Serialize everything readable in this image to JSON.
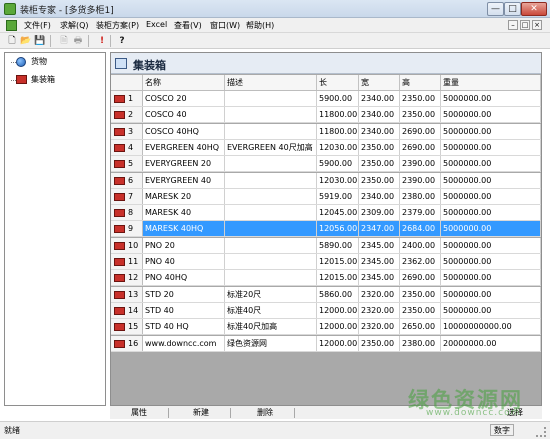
{
  "window": {
    "title": "装柜专家 - [多货多柜1]",
    "controls": {
      "minimize": "—",
      "maximize": "□",
      "close": "✕"
    }
  },
  "menubar": {
    "items": [
      "文件(F)",
      "求解(Q)",
      "装柜方案(P)",
      "Excel",
      "查看(V)",
      "窗口(W)",
      "帮助(H)"
    ],
    "mdi_controls": [
      "–",
      "□",
      "×"
    ]
  },
  "toolbar": {
    "glyphs": [
      "🗋",
      "📂",
      "💾",
      "🗎",
      "🖶",
      "!",
      "?"
    ]
  },
  "tree": {
    "items": [
      {
        "label": "货物",
        "icon": "ball-icon"
      },
      {
        "label": "集装箱",
        "icon": "container-icon"
      }
    ]
  },
  "panel": {
    "title": "集装箱"
  },
  "table": {
    "columns": [
      "名称",
      "描述",
      "长",
      "宽",
      "高",
      "重量"
    ],
    "rows": [
      {
        "num": "1",
        "name": "COSCO 20",
        "desc": "",
        "length": "5900.00",
        "width": "2340.00",
        "height": "2350.00",
        "weight": "5000000.00"
      },
      {
        "num": "2",
        "name": "COSCO 40",
        "desc": "",
        "length": "11800.00",
        "width": "2340.00",
        "height": "2350.00",
        "weight": "5000000.00"
      },
      {
        "num": "3",
        "name": "COSCO 40HQ",
        "desc": "",
        "length": "11800.00",
        "width": "2340.00",
        "height": "2690.00",
        "weight": "5000000.00"
      },
      {
        "num": "4",
        "name": "EVERGREEN 40HQ",
        "desc": "EVERGREEN 40尺加高",
        "length": "12030.00",
        "width": "2350.00",
        "height": "2690.00",
        "weight": "5000000.00"
      },
      {
        "num": "5",
        "name": "EVERYGREEN 20",
        "desc": "",
        "length": "5900.00",
        "width": "2350.00",
        "height": "2390.00",
        "weight": "5000000.00"
      },
      {
        "num": "6",
        "name": "EVERYGREEN 40",
        "desc": "",
        "length": "12030.00",
        "width": "2350.00",
        "height": "2390.00",
        "weight": "5000000.00"
      },
      {
        "num": "7",
        "name": "MARESK 20",
        "desc": "",
        "length": "5919.00",
        "width": "2340.00",
        "height": "2380.00",
        "weight": "5000000.00"
      },
      {
        "num": "8",
        "name": "MARESK 40",
        "desc": "",
        "length": "12045.00",
        "width": "2309.00",
        "height": "2379.00",
        "weight": "5000000.00"
      },
      {
        "num": "9",
        "name": "MARESK 40HQ",
        "desc": "",
        "length": "12056.00",
        "width": "2347.00",
        "height": "2684.00",
        "weight": "5000000.00"
      },
      {
        "num": "10",
        "name": "PNO 20",
        "desc": "",
        "length": "5890.00",
        "width": "2345.00",
        "height": "2400.00",
        "weight": "5000000.00"
      },
      {
        "num": "11",
        "name": "PNO 40",
        "desc": "",
        "length": "12015.00",
        "width": "2345.00",
        "height": "2362.00",
        "weight": "5000000.00"
      },
      {
        "num": "12",
        "name": "PNO 40HQ",
        "desc": "",
        "length": "12015.00",
        "width": "2345.00",
        "height": "2690.00",
        "weight": "5000000.00"
      },
      {
        "num": "13",
        "name": "STD 20",
        "desc": "标准20尺",
        "length": "5860.00",
        "width": "2320.00",
        "height": "2350.00",
        "weight": "5000000.00"
      },
      {
        "num": "14",
        "name": "STD 40",
        "desc": "标准40尺",
        "length": "12000.00",
        "width": "2320.00",
        "height": "2350.00",
        "weight": "5000000.00"
      },
      {
        "num": "15",
        "name": "STD 40 HQ",
        "desc": "标准40尺加高",
        "length": "12000.00",
        "width": "2320.00",
        "height": "2650.00",
        "weight": "10000000000.00"
      },
      {
        "num": "16",
        "name": "www.downcc.com",
        "desc": "绿色资源网",
        "length": "12000.00",
        "width": "2350.00",
        "height": "2380.00",
        "weight": "20000000.00"
      }
    ],
    "selected_row": 9
  },
  "bottom_tabs": [
    "属性",
    "新建",
    "删除",
    "选择"
  ],
  "status": {
    "left": "就绪",
    "right": "数字"
  },
  "watermark": {
    "main": "绿色资源网",
    "sub": "www.downcc.com"
  },
  "colors": {
    "selection": "#3399ff",
    "container_icon": "#c8302a",
    "grid_empty_bg": "#a9a9a9"
  }
}
